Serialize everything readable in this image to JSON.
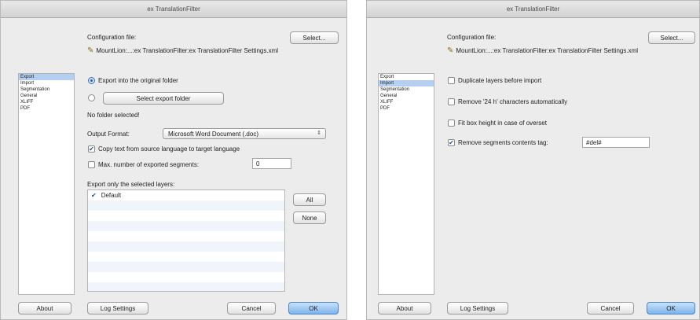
{
  "left_dialog": {
    "title": "ex TranslationFilter",
    "config_label": "Configuration file:",
    "select_button": "Select...",
    "config_path": "MountLion:...:ex TranslationFilter:ex TranslationFilter Settings.xml",
    "sidebar": {
      "items": [
        {
          "label": "Export",
          "selected": true
        },
        {
          "label": "Import",
          "selected": false
        },
        {
          "label": "Segmentation",
          "selected": false
        },
        {
          "label": "General",
          "selected": false
        },
        {
          "label": "XLIFF",
          "selected": false
        },
        {
          "label": "PDF",
          "selected": false
        }
      ]
    },
    "export_original_label": "Export into the original folder",
    "select_export_folder_button": "Select export folder",
    "no_folder_text": "No folder selected!",
    "output_format_label": "Output Format:",
    "output_format_value": "Microsoft Word Document (.doc)",
    "copy_text_label": "Copy text from source language to target language",
    "max_segments_label": "Max. number of exported segments:",
    "max_segments_value": "0",
    "export_layers_label": "Export only the selected layers:",
    "layers": [
      {
        "label": "Default",
        "checked": true
      }
    ],
    "all_button": "All",
    "none_button": "None",
    "about_button": "About",
    "log_settings_button": "Log Settings",
    "cancel_button": "Cancel",
    "ok_button": "OK"
  },
  "right_dialog": {
    "title": "ex TranslationFilter",
    "config_label": "Configuration file:",
    "select_button": "Select...",
    "config_path": "MountLion:...:ex TranslationFilter:ex TranslationFilter Settings.xml",
    "sidebar": {
      "items": [
        {
          "label": "Export",
          "selected": false
        },
        {
          "label": "Import",
          "selected": true
        },
        {
          "label": "Segmentation",
          "selected": false
        },
        {
          "label": "General",
          "selected": false
        },
        {
          "label": "XLIFF",
          "selected": false
        },
        {
          "label": "PDF",
          "selected": false
        }
      ]
    },
    "duplicate_layers_label": "Duplicate layers before import",
    "remove_24h_label": "Remove '24 h' characters automatically",
    "fit_box_label": "Fit box height in case of overset",
    "remove_tag_label": "Remove segments contents tag:",
    "remove_tag_value": "#del#",
    "about_button": "About",
    "log_settings_button": "Log Settings",
    "cancel_button": "Cancel",
    "ok_button": "OK"
  },
  "icons": {
    "pencil": "pencil-icon",
    "check": "✔",
    "select_arrows": "⇕"
  },
  "colors": {
    "accent": "#7cb3ea",
    "selection": "#b5cff0",
    "dialog_bg": "#ececec"
  }
}
